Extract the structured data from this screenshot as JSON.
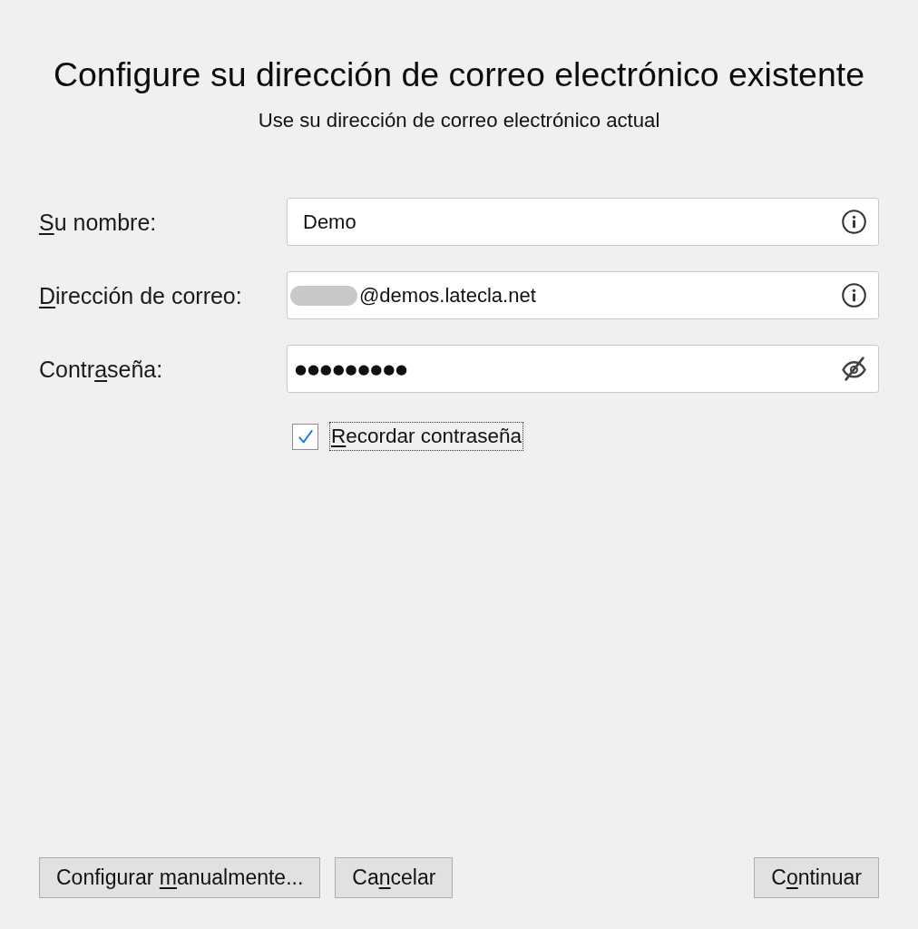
{
  "dialog": {
    "title": "Configure su dirección de correo electrónico existente",
    "subtitle": "Use su dirección de correo electrónico actual"
  },
  "fields": [
    {
      "label": [
        {
          "text": "S",
          "access_key": true
        },
        {
          "text": "u nombre:",
          "access_key": false
        }
      ],
      "kind": "text",
      "value": "Demo",
      "redacted": false
    },
    {
      "label": [
        {
          "text": "D",
          "access_key": true
        },
        {
          "text": "irección de correo:",
          "access_key": false
        }
      ],
      "kind": "email",
      "value": "@demos.latecla.net",
      "redacted": true
    },
    {
      "label": [
        {
          "text": "Contr",
          "access_key": false
        },
        {
          "text": "a",
          "access_key": true
        },
        {
          "text": "seña:",
          "access_key": false
        }
      ],
      "kind": "password",
      "value": "●●●●●●●●●",
      "redacted": false
    }
  ],
  "checkbox": {
    "label": [
      {
        "text": "R",
        "access_key": true
      },
      {
        "text": "ecordar contraseña",
        "access_key": false
      }
    ],
    "checked": true,
    "focused": true
  },
  "footer": {
    "left_buttons": [
      {
        "label": [
          {
            "text": "Configurar ",
            "access_key": false
          },
          {
            "text": "m",
            "access_key": true
          },
          {
            "text": "anualmente...",
            "access_key": false
          }
        ]
      },
      {
        "label": [
          {
            "text": "Ca",
            "access_key": false
          },
          {
            "text": "n",
            "access_key": true
          },
          {
            "text": "celar",
            "access_key": false
          }
        ]
      }
    ],
    "right_buttons": [
      {
        "label": [
          {
            "text": "C",
            "access_key": false
          },
          {
            "text": "o",
            "access_key": true
          },
          {
            "text": "ntinuar",
            "access_key": false
          }
        ]
      }
    ]
  }
}
